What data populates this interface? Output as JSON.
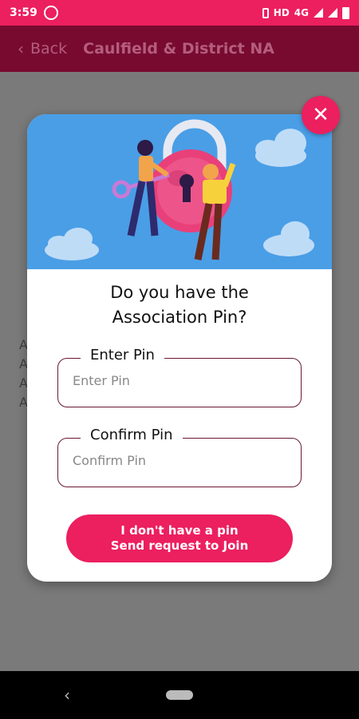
{
  "status_bar": {
    "time": "3:59",
    "network": "HD",
    "signal": "4G"
  },
  "app_bar": {
    "back_label": "Back",
    "title": "Caulfield & District NA"
  },
  "background": {
    "lines": [
      "A",
      "A",
      "A",
      "A"
    ]
  },
  "dialog": {
    "title_line1": "Do you have the",
    "title_line2": "Association Pin?",
    "pin_field": {
      "label": "Enter Pin",
      "placeholder": "Enter Pin"
    },
    "confirm_field": {
      "label": "Confirm Pin",
      "placeholder": "Confirm Pin"
    },
    "join_button": {
      "line1": "I don't have a pin",
      "line2": "Send request to Join"
    }
  },
  "colors": {
    "accent": "#ec1f5f",
    "app_bar": "#780a30",
    "hero_sky": "#4a9ee6"
  },
  "icons": {
    "close": "close-icon",
    "back": "chevron-left-icon",
    "illustration": "padlock-people-illustration"
  }
}
